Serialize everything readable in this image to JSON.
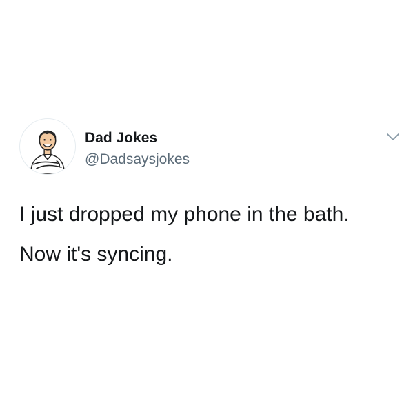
{
  "tweet": {
    "author": {
      "display_name": "Dad Jokes",
      "handle": "@Dadsaysjokes",
      "avatar_icon": "dad-cartoon-avatar"
    },
    "menu_icon": "chevron-down-icon",
    "lines": [
      "I just dropped my phone in the bath.",
      "Now it's syncing."
    ]
  },
  "colors": {
    "text_primary": "#14171a",
    "text_secondary": "#5b6b78",
    "chevron": "#8899a6",
    "background": "#ffffff"
  }
}
